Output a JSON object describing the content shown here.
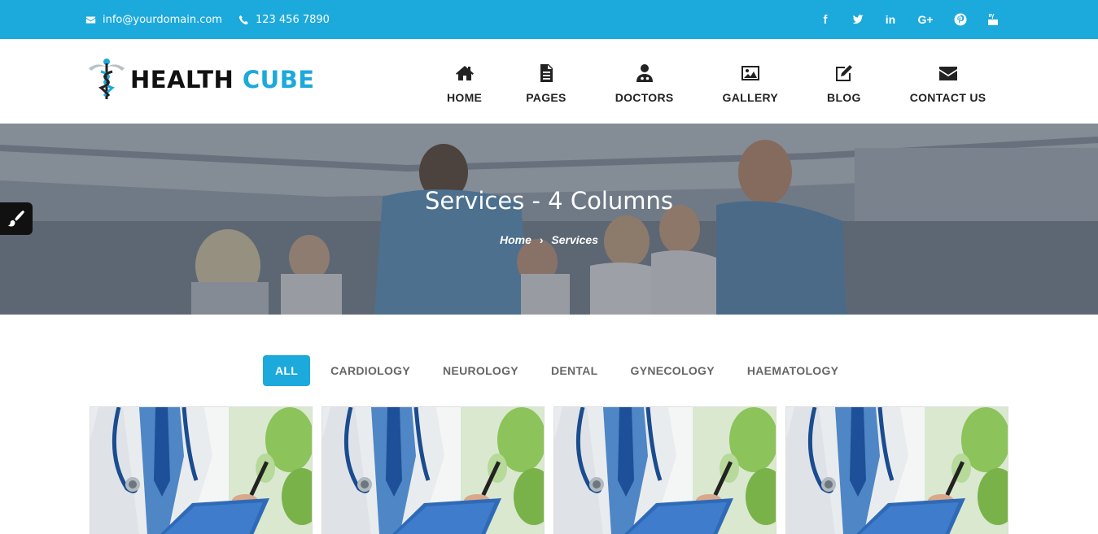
{
  "topbar": {
    "email": "info@yourdomain.com",
    "phone": "123 456 7890",
    "social": [
      "facebook-icon",
      "twitter-icon",
      "linkedin-icon",
      "google-plus-icon",
      "pinterest-icon",
      "youtube-icon"
    ]
  },
  "brand": {
    "part1": "HEALTH",
    "part2": "CUBE",
    "accent": "#1ca9dc"
  },
  "nav": [
    {
      "label": "HOME",
      "icon": "home-icon"
    },
    {
      "label": "PAGES",
      "icon": "document-icon"
    },
    {
      "label": "DOCTORS",
      "icon": "doctor-icon"
    },
    {
      "label": "GALLERY",
      "icon": "image-icon"
    },
    {
      "label": "BLOG",
      "icon": "edit-icon"
    },
    {
      "label": "CONTACT US",
      "icon": "envelope-icon"
    }
  ],
  "hero": {
    "title": "Services - 4 Columns",
    "breadcrumb": {
      "home": "Home",
      "separator": "›",
      "current": "Services"
    }
  },
  "filters": [
    "ALL",
    "CARDIOLOGY",
    "NEUROLOGY",
    "DENTAL",
    "GYNECOLOGY",
    "HAEMATOLOGY"
  ],
  "active_filter": "ALL",
  "cards": [
    {
      "image": "doctor-clipboard-image"
    },
    {
      "image": "doctor-clipboard-image"
    },
    {
      "image": "doctor-clipboard-image"
    },
    {
      "image": "doctor-clipboard-image"
    }
  ]
}
